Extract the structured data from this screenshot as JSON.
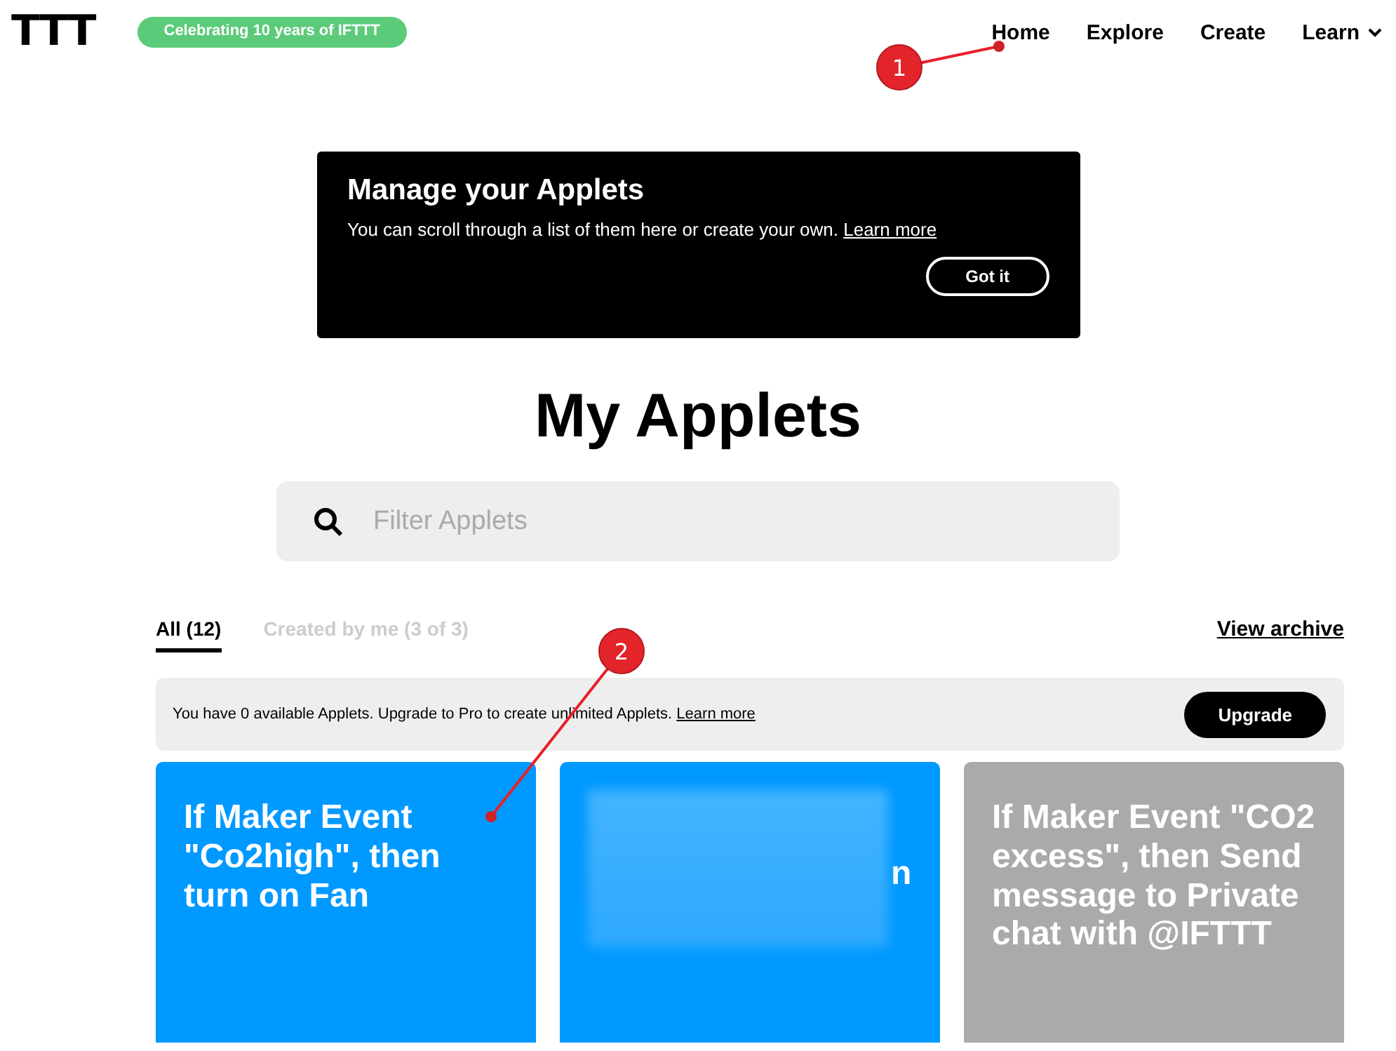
{
  "header": {
    "logo": "TTT",
    "badge": "Celebrating 10 years of IFTTT",
    "nav": [
      {
        "label": "Home",
        "kind": "link"
      },
      {
        "label": "Explore",
        "kind": "link"
      },
      {
        "label": "Create",
        "kind": "link"
      },
      {
        "label": "Learn",
        "kind": "dropdown"
      }
    ]
  },
  "banner": {
    "title": "Manage your Applets",
    "text": "You can scroll through a list of them here or create your own.",
    "link": "Learn more",
    "button": "Got it"
  },
  "heading": "My Applets",
  "search": {
    "placeholder": "Filter Applets"
  },
  "tabs": [
    {
      "label": "All (12)",
      "selected": true
    },
    {
      "label": "Created by me (3 of 3)",
      "selected": false
    }
  ],
  "archive_link": "View archive",
  "upgrade_bar": {
    "text": "You have 0 available Applets. Upgrade to Pro to create unlimited Applets.",
    "link": "Learn more",
    "button": "Upgrade"
  },
  "applets": [
    {
      "title": "If Maker Event \"Co2high\", then turn on Fan",
      "color": "#0099ff",
      "blurred": false
    },
    {
      "title": "n",
      "color": "#0099ff",
      "blurred": true
    },
    {
      "title": "If Maker Event \"CO2 excess\", then Send message to Private chat with @IFTTT",
      "color": "#aaaaaa",
      "blurred": false
    }
  ],
  "annotations": [
    {
      "number": "1"
    },
    {
      "number": "2"
    }
  ]
}
